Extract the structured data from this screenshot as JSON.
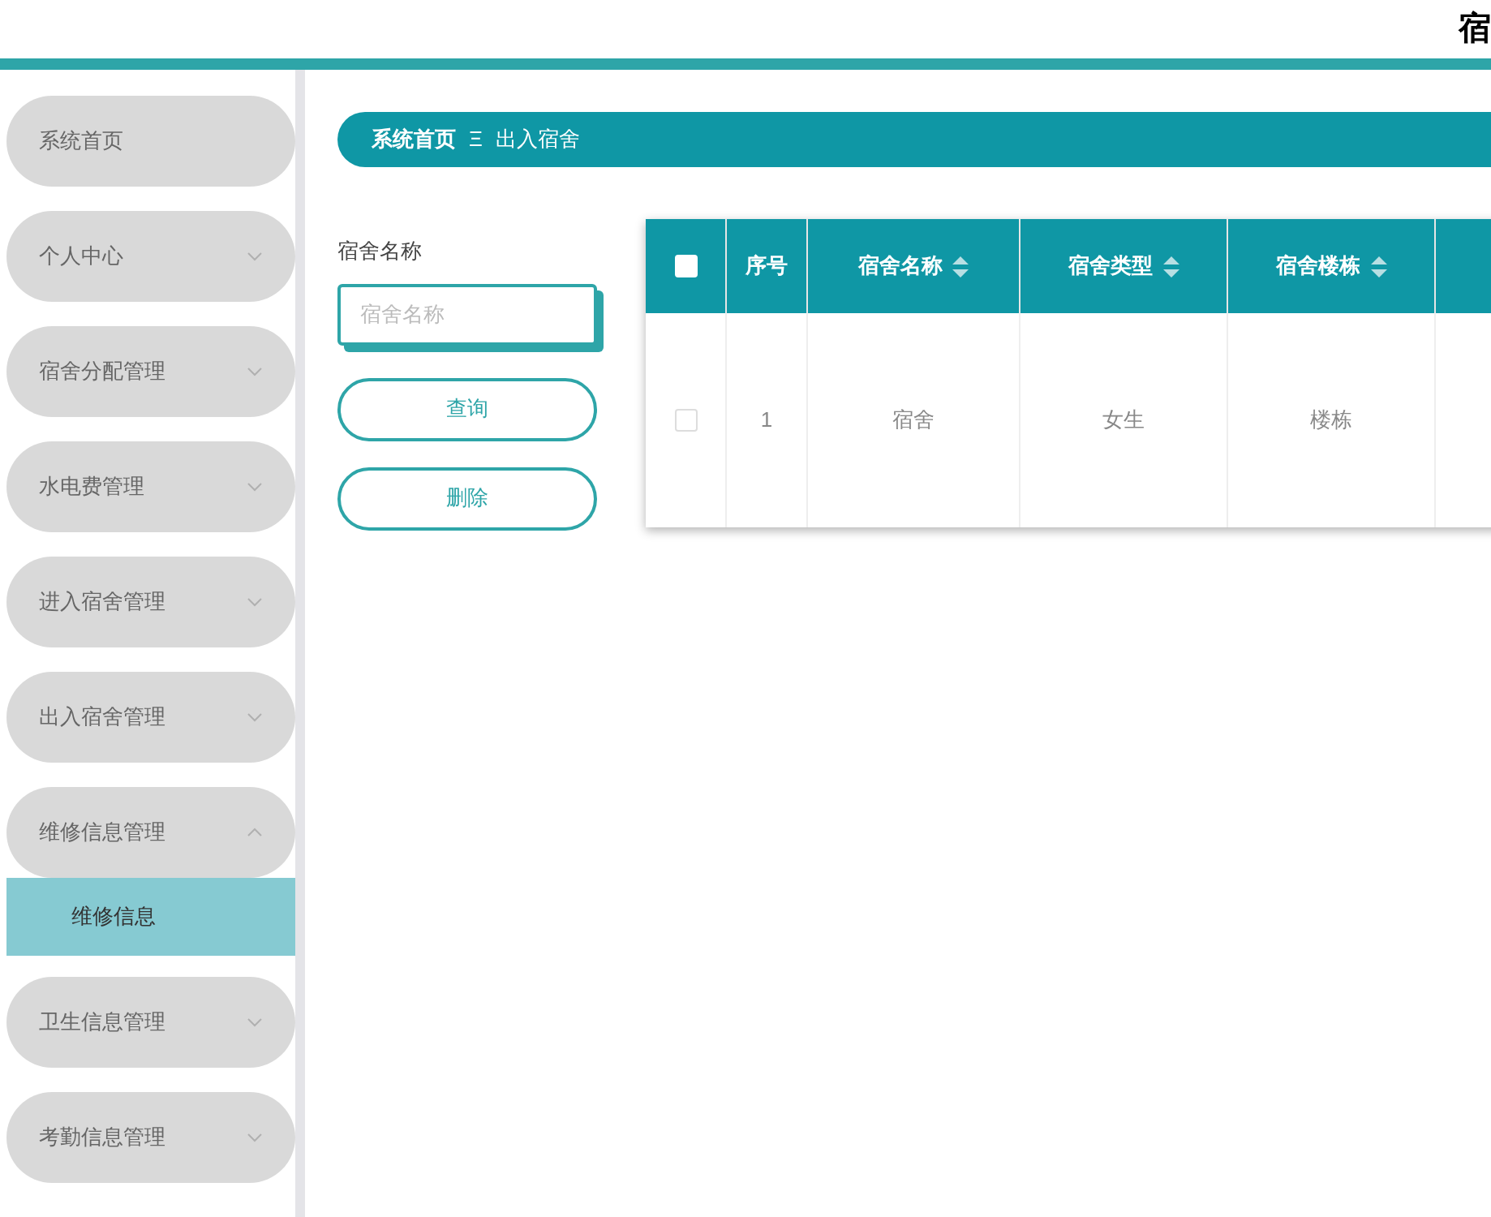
{
  "header": {
    "title": "宿"
  },
  "sidebar": {
    "items": [
      {
        "label": "系统首页",
        "kind": "link"
      },
      {
        "label": "个人中心",
        "kind": "menu",
        "expanded": false
      },
      {
        "label": "宿舍分配管理",
        "kind": "menu",
        "expanded": false
      },
      {
        "label": "水电费管理",
        "kind": "menu",
        "expanded": false
      },
      {
        "label": "进入宿舍管理",
        "kind": "menu",
        "expanded": false
      },
      {
        "label": "出入宿舍管理",
        "kind": "menu",
        "expanded": false
      },
      {
        "label": "维修信息管理",
        "kind": "menu",
        "expanded": true,
        "children": [
          {
            "label": "维修信息",
            "selected": true
          }
        ]
      },
      {
        "label": "卫生信息管理",
        "kind": "menu",
        "expanded": false
      },
      {
        "label": "考勤信息管理",
        "kind": "menu",
        "expanded": false
      }
    ]
  },
  "breadcrumb": {
    "items": [
      "系统首页",
      "出入宿舍"
    ],
    "separator": "Ξ"
  },
  "search": {
    "label": "宿舍名称",
    "placeholder": "宿舍名称"
  },
  "buttons": [
    "查询",
    "删除"
  ],
  "table": {
    "select_all_checked": false,
    "columns": [
      {
        "label": "序号",
        "sortable": false
      },
      {
        "label": "宿舍名称",
        "sortable": true
      },
      {
        "label": "宿舍类型",
        "sortable": true
      },
      {
        "label": "宿舍楼栋",
        "sortable": true
      }
    ],
    "rows": [
      {
        "checked": false,
        "cells": [
          "1",
          "宿舍",
          "女生",
          "楼栋"
        ]
      }
    ]
  }
}
